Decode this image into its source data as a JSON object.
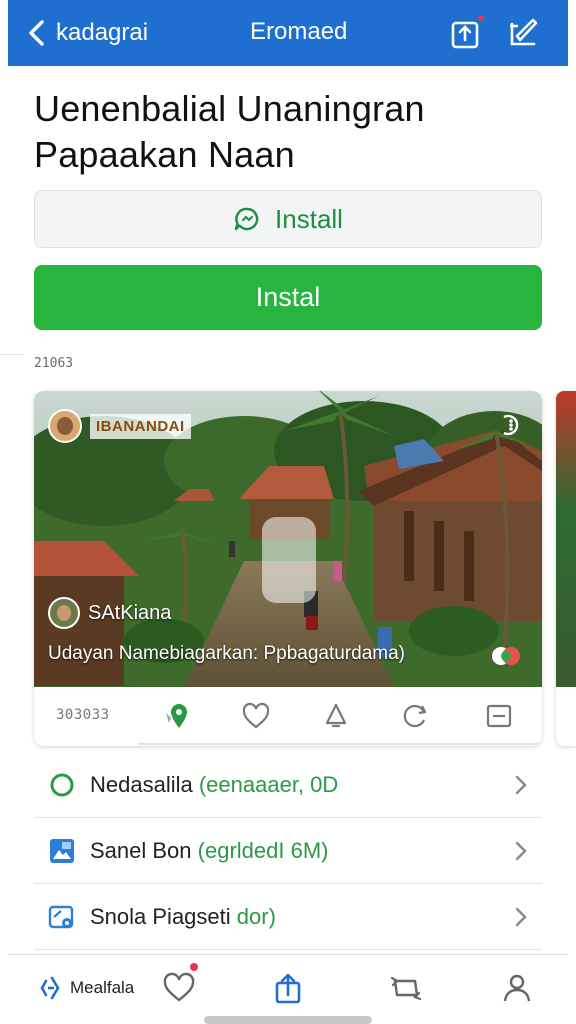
{
  "topbar": {
    "back_label": "kadagrai",
    "title": "Eromaed",
    "bg_color": "#1f6fd1"
  },
  "page": {
    "title_line1": "Uenenbalial  Unaningran",
    "title_line2": "Papaakan Naan"
  },
  "install": {
    "outline_label": "Install",
    "primary_label": "Instal",
    "accent_color": "#27b43f"
  },
  "meta": {
    "small_text": "21063"
  },
  "post": {
    "badge_label": "IBANANDAI",
    "author_name": "SAtKiana",
    "caption": "Udayan Namebiagarkan: Ppbagaturdama)",
    "count_text": "303033"
  },
  "list": [
    {
      "label": "Nedasalila",
      "detail": "(eenaaaer, 0D",
      "icon": "circle-outline-icon"
    },
    {
      "label": "Sanel Bon",
      "detail": "(egrldedI 6M)",
      "icon": "image-file-icon"
    },
    {
      "label": "Snola Piagseti",
      "detail": "dor)",
      "icon": "camera-file-icon"
    }
  ],
  "bottom_nav": {
    "home_label": "Mealfala",
    "items": [
      "home-icon",
      "heart-icon",
      "share-icon",
      "repost-icon",
      "profile-icon"
    ]
  }
}
